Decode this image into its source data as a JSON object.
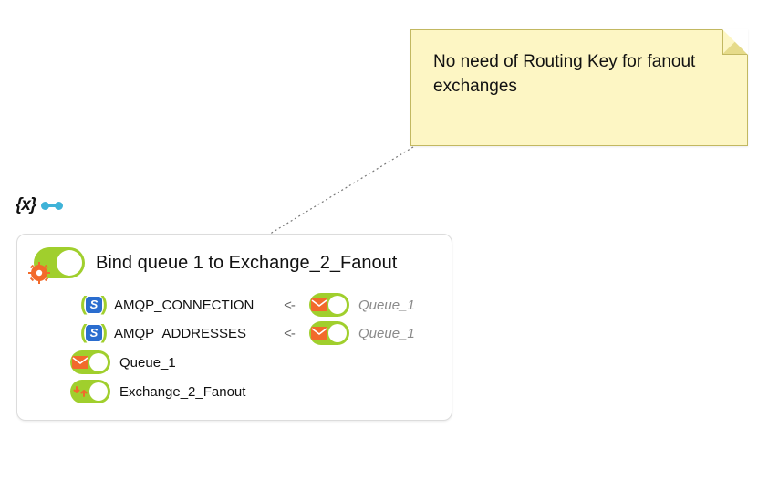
{
  "note": {
    "text": "No need of Routing Key for fanout exchanges"
  },
  "node": {
    "title": "Bind queue 1  to Exchange_2_Fanout",
    "params": [
      {
        "name": "AMQP_CONNECTION",
        "arrow": "<-",
        "source": "Queue_1"
      },
      {
        "name": "AMQP_ADDRESSES",
        "arrow": "<-",
        "source": "Queue_1"
      }
    ],
    "items": [
      {
        "label": "Queue_1",
        "overlay": "mail"
      },
      {
        "label": "Exchange_2_Fanout",
        "overlay": "swap"
      }
    ]
  },
  "icons": {
    "variable_badge": "{x}",
    "s_letter": "S"
  }
}
